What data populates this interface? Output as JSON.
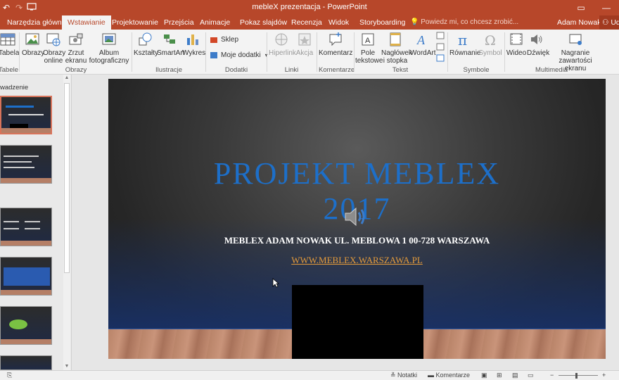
{
  "window": {
    "title": "mebleX prezentacja - PowerPoint",
    "qat": {
      "undo": "↶",
      "redo": "↷"
    }
  },
  "tabs": [
    {
      "label": "Narzędzia główne"
    },
    {
      "label": "Wstawianie",
      "active": true
    },
    {
      "label": "Projektowanie"
    },
    {
      "label": "Przejścia"
    },
    {
      "label": "Animacje"
    },
    {
      "label": "Pokaz slajdów"
    },
    {
      "label": "Recenzja"
    },
    {
      "label": "Widok"
    },
    {
      "label": "Storyboarding"
    }
  ],
  "tell_me": "Powiedz mi, co chcesz zrobić...",
  "user": "Adam Nowak",
  "share": "Ud",
  "ribbon": {
    "tabele": {
      "button": "Tabela",
      "group": "Tabele"
    },
    "obrazy": {
      "obrazy": "Obrazy",
      "online": "Obrazy online",
      "zrzut": "Zrzut ekranu",
      "album": "Album fotograficzny",
      "group": "Obrazy"
    },
    "ilustracje": {
      "ksztalty": "Kształty",
      "smartart": "SmartArt",
      "wykres": "Wykres",
      "group": "Ilustracje"
    },
    "dodatki": {
      "sklep": "Sklep",
      "moje": "Moje dodatki",
      "group": "Dodatki"
    },
    "linki": {
      "hiperlink": "Hiperlink",
      "akcja": "Akcja",
      "group": "Linki"
    },
    "komentarze": {
      "komentarz": "Komentarz",
      "group": "Komentarze"
    },
    "tekst": {
      "pole": "Pole tekstowe",
      "naglowek": "Nagłówek i stopka",
      "wordart": "WordArt",
      "group": "Tekst"
    },
    "symbole": {
      "rownanie": "Równanie",
      "symbol": "Symbol",
      "group": "Symbole"
    },
    "multimedia": {
      "wideo": "Wideo",
      "dzwiek": "Dźwięk",
      "nagranie": "Nagranie zawartości ekranu",
      "group": "Multimedia"
    }
  },
  "left_pane": {
    "section_label": "wadzenie"
  },
  "slide": {
    "title_line1": "PROJEKT MEBLEX",
    "title_line2": "2017",
    "subtitle": "MEBLEX ADAM NOWAK UL. MEBLOWA 1 00-728 WARSZAWA",
    "link": "WWW.MEBLEX.WARSZAWA.PL"
  },
  "statusbar": {
    "notes": "Notatki",
    "comments": "Komentarze"
  },
  "colors": {
    "accent": "#b7472a",
    "title_blue": "#1d6fc9",
    "link_orange": "#e49b3b"
  }
}
